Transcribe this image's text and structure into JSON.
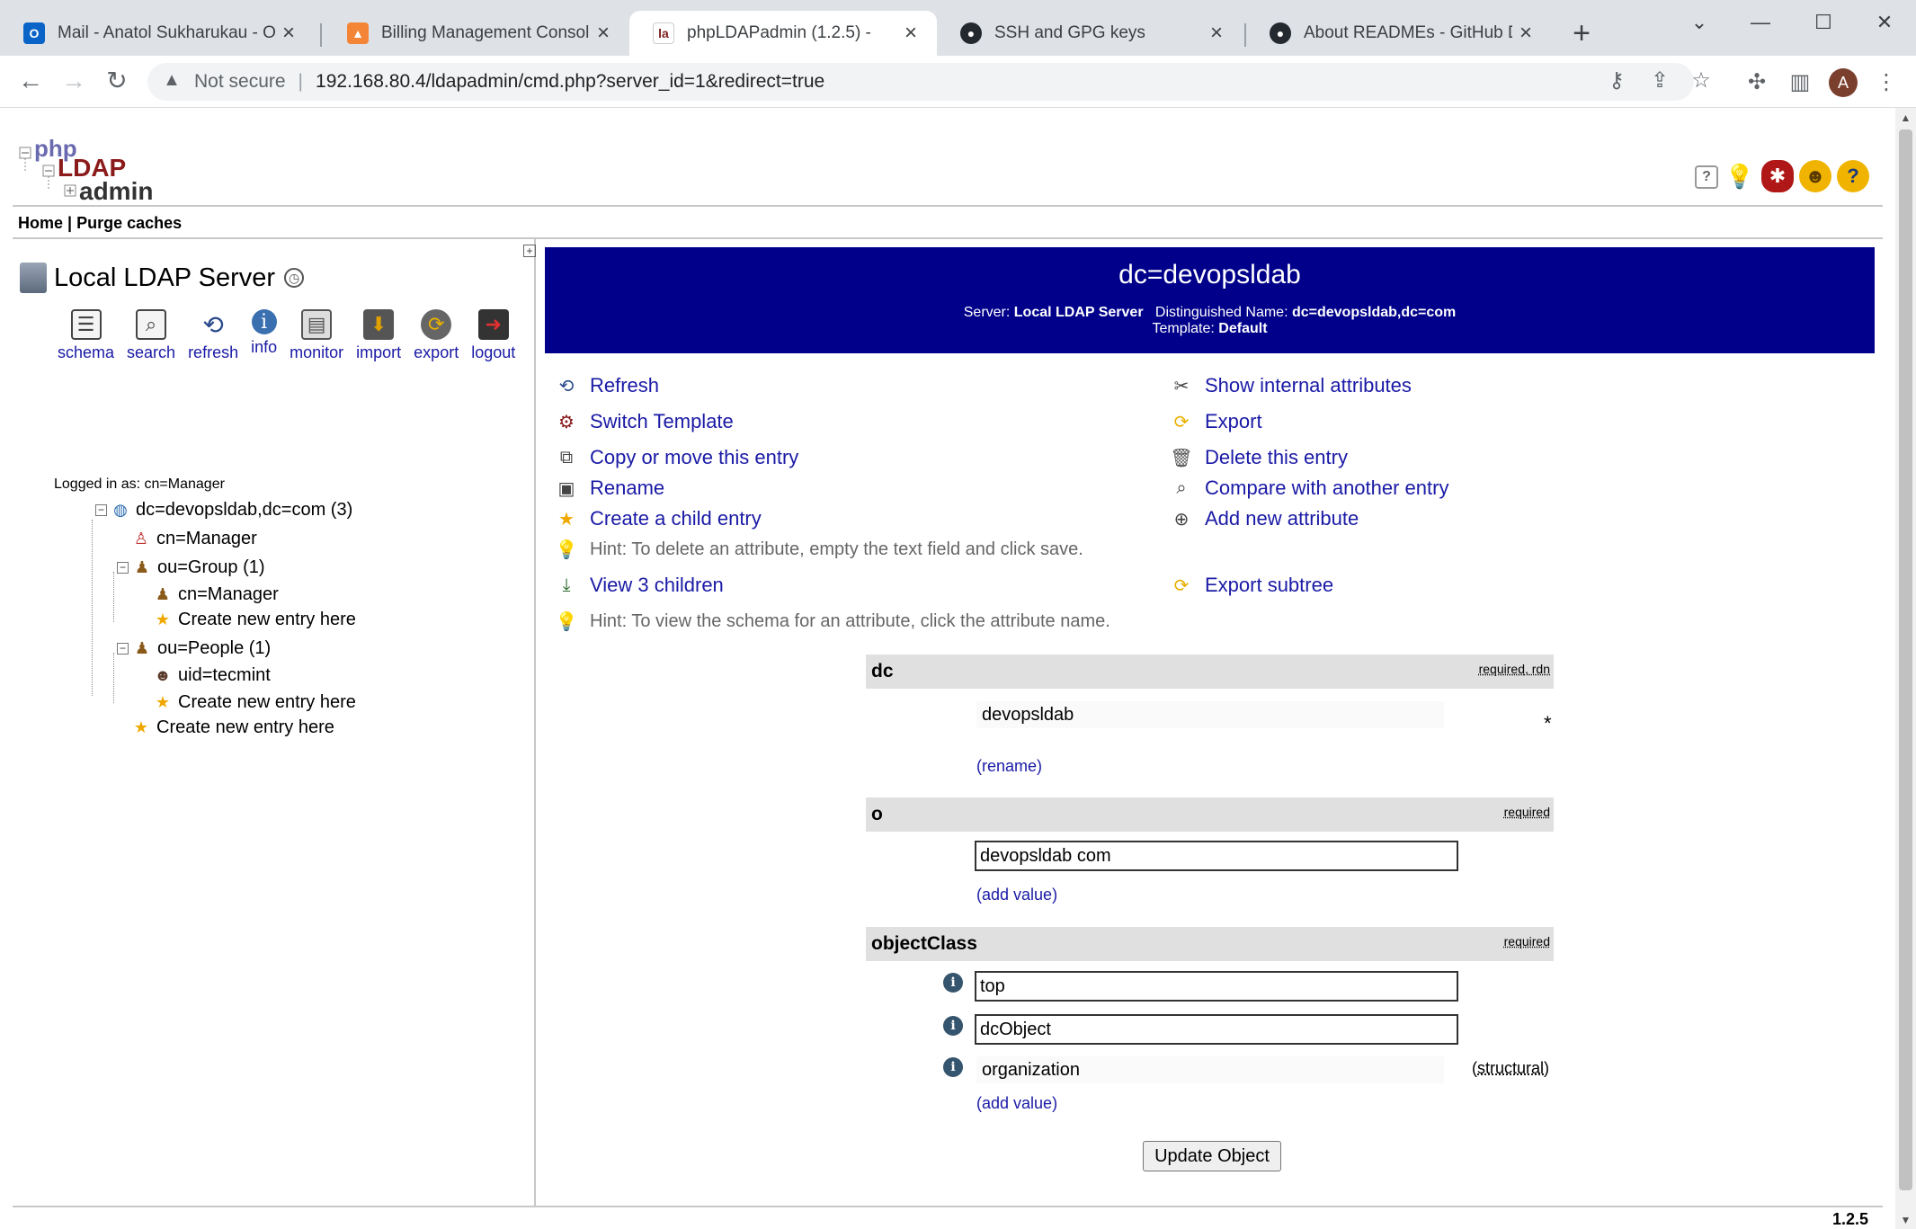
{
  "browser": {
    "tabs": [
      {
        "label": "Mail - Anatol Sukharukau - Out",
        "icon": "outlook-icon",
        "color": "#0a64c8"
      },
      {
        "label": "Billing Management Console",
        "icon": "aws-icon",
        "color": "#f58536"
      },
      {
        "label": "phpLDAPadmin (1.2.5) -",
        "icon": "phpldapadmin-icon",
        "color": "#7a1f1f"
      },
      {
        "label": "SSH and GPG keys",
        "icon": "github-icon",
        "color": "#24292f"
      },
      {
        "label": "About READMEs - GitHub Docs",
        "icon": "github-icon",
        "color": "#24292f"
      }
    ],
    "not_secure": "Not secure",
    "url": "192.168.80.4/ldapadmin/cmd.php?server_id=1&redirect=true",
    "profile_initial": "A"
  },
  "header": {
    "logo_text": "phpLDAPadmin",
    "menu": {
      "home": "Home",
      "separator": "|",
      "purge": "Purge caches"
    }
  },
  "server": {
    "name": "Local LDAP Server",
    "tools": [
      {
        "label": "schema",
        "icon": "schema-icon"
      },
      {
        "label": "search",
        "icon": "search-icon"
      },
      {
        "label": "refresh",
        "icon": "refresh-icon"
      },
      {
        "label": "info",
        "icon": "info-icon"
      },
      {
        "label": "monitor",
        "icon": "monitor-icon"
      },
      {
        "label": "import",
        "icon": "import-icon"
      },
      {
        "label": "export",
        "icon": "export-icon"
      },
      {
        "label": "logout",
        "icon": "logout-icon"
      }
    ],
    "logged_in": "Logged in as: cn=Manager"
  },
  "tree": {
    "root": "dc=devopsldab,dc=com (3)",
    "cn_manager": "cn=Manager",
    "ou_group": "ou=Group (1)",
    "group_cn_manager": "cn=Manager",
    "group_create": "Create new entry here",
    "ou_people": "ou=People (1)",
    "uid_tecmint": "uid=tecmint",
    "people_create": "Create new entry here",
    "root_create": "Create new entry here"
  },
  "entry": {
    "dn_title": "dc=devopsldab",
    "server_label": "Server:",
    "server_value": "Local LDAP Server",
    "dn_label": "Distinguished Name:",
    "dn_value": "dc=devopsldab,dc=com",
    "template_label": "Template:",
    "template_value": "Default"
  },
  "actions": {
    "refresh": "Refresh",
    "switch_template": "Switch Template",
    "copy_move": "Copy or move this entry",
    "rename": "Rename",
    "create_child": "Create a child entry",
    "hint_delete": "Hint: To delete an attribute, empty the text field and click save.",
    "view_children": "View 3 children",
    "hint_schema": "Hint: To view the schema for an attribute, click the attribute name.",
    "show_internal": "Show internal attributes",
    "export": "Export",
    "delete": "Delete this entry",
    "compare": "Compare with another entry",
    "add_attribute": "Add new attribute",
    "export_subtree": "Export subtree"
  },
  "attributes": {
    "dc": {
      "name": "dc",
      "flags_required": "required",
      "flags_sep": ",",
      "flags_rdn": "rdn",
      "value": "devopsldab",
      "star": "*",
      "rename_link": "rename"
    },
    "o": {
      "name": "o",
      "flag": "required",
      "value": "devopsldab com",
      "add_value": "add value"
    },
    "objectClass": {
      "name": "objectClass",
      "flag": "required",
      "values": [
        "top",
        "dcObject",
        "organization"
      ],
      "structural": "structural",
      "add_value": "add value"
    }
  },
  "update_button": "Update Object",
  "version": "1.2.5"
}
